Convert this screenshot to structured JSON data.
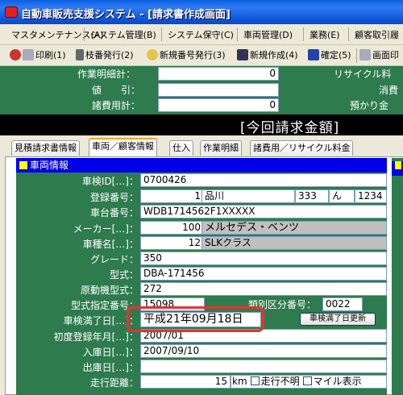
{
  "window": {
    "title": "自動車販売支援システム - [請求書作成画面]"
  },
  "menu": {
    "items": [
      "マスタメンテナンス(A)",
      "システム管理(B)",
      "システム保守(C)",
      "車両管理(D)",
      "業務(E)",
      "顧客取引履"
    ]
  },
  "toolbar": {
    "items": [
      "印刷(1)",
      "枝番発行(2)",
      "新規番号発行(3)",
      "新規作成(4)",
      "確定(5)",
      "画面印"
    ]
  },
  "summary": {
    "rows": [
      {
        "label": "作業明細計：",
        "value": "0",
        "right_label": "リサイクル料"
      },
      {
        "label": "値　　引：",
        "value": "",
        "right_label": "消費"
      },
      {
        "label": "諸費用計：",
        "value": "0",
        "right_label": "預かり金"
      }
    ]
  },
  "banner": {
    "text": "[今回請求金額]"
  },
  "tabs": [
    "見積請求書情報",
    "車両／顧客情報",
    "仕入",
    "作業明細",
    "諸費用／リサイクル料金"
  ],
  "vehicle": {
    "section_title": "車両情報",
    "rows": [
      {
        "label": "車検ID[…]：",
        "value": "0700426"
      },
      {
        "label": "登録番号：",
        "value": "1",
        "place": "品川",
        "cls": "333",
        "kana": "ん",
        "num": "1234"
      },
      {
        "label": "車台番号：",
        "value": "WDB1714562F1XXXXX"
      },
      {
        "label": "メーカー[…]：",
        "value": "100",
        "text": "メルセデス・ベンツ"
      },
      {
        "label": "車種名[…]：",
        "value": "12",
        "text": "SLKクラス"
      },
      {
        "label": "グレード：",
        "value": "350"
      },
      {
        "label": "型式：",
        "value": "DBA-171456"
      },
      {
        "label": "原動機型式：",
        "value": "272"
      },
      {
        "label": "型式指定番号：",
        "value": "15098",
        "extra_label": "類別区分番号：",
        "extra_value": "0022"
      },
      {
        "label": "車検満了日[…]：",
        "value": "平成21年09月18日",
        "button": "車検満了日更新"
      },
      {
        "label": "初度登録年月[…]：",
        "value": "2007/01"
      },
      {
        "label": "入庫日[…]：",
        "value": "2007/09/10"
      },
      {
        "label": "出庫日[…]：",
        "value": ""
      },
      {
        "label": "走行距離：",
        "value": "15",
        "unit": "km",
        "opt1": "走行不明",
        "opt2": "マイル表示"
      }
    ]
  }
}
